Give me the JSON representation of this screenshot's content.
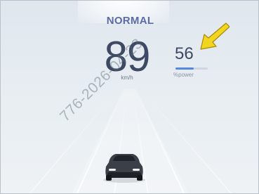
{
  "drive_mode": "NORMAL",
  "speed": {
    "value": "89",
    "unit": "km/h"
  },
  "power": {
    "value": "56",
    "unit": "%power",
    "level_percent": 56
  },
  "watermark_text": "776-2026-04-23",
  "colors": {
    "mode_text": "#5b6aa4",
    "speed_text": "#3e4a63",
    "power_bar": "#5786df",
    "annotation_arrow": "#f2d51f"
  },
  "icons": {
    "annotation": "yellow-arrow-icon",
    "vehicle": "car-icon"
  }
}
